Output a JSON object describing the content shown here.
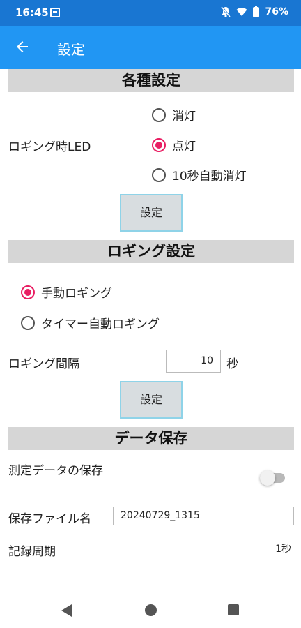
{
  "status_bar": {
    "time": "16:45",
    "battery": "76%",
    "icons": [
      "notification-icon",
      "bell-off-icon",
      "wifi-icon",
      "battery-icon"
    ]
  },
  "app_bar": {
    "title": "設定",
    "back_icon": "arrow-back-icon",
    "color": "#2196f3"
  },
  "led_section": {
    "header": "各種設定",
    "label": "ロギング時LED",
    "options": [
      {
        "label": "消灯",
        "selected": false
      },
      {
        "label": "点灯",
        "selected": true
      },
      {
        "label": "10秒自動消灯",
        "selected": false
      }
    ],
    "button": "設定"
  },
  "logging_section": {
    "header": "ロギング設定",
    "options": [
      {
        "label": "手動ロギング",
        "selected": true
      },
      {
        "label": "タイマー自動ロギング",
        "selected": false
      }
    ],
    "interval_label": "ロギング間隔",
    "interval_value": "10",
    "interval_unit": "秒",
    "button": "設定"
  },
  "data_section": {
    "header": "データ保存",
    "save_label": "測定データの保存",
    "save_enabled": false,
    "filename_label": "保存ファイル名",
    "filename_value": "20240729_1315",
    "period_label": "記録周期",
    "period_value": "1秒"
  },
  "nav_bar": {
    "icons": [
      "nav-back-icon",
      "nav-home-icon",
      "nav-recents-icon"
    ]
  },
  "colors": {
    "accent": "#e91e63",
    "primary": "#2196f3",
    "status_bar": "#1976d2",
    "section_header": "#d6d6d6"
  }
}
